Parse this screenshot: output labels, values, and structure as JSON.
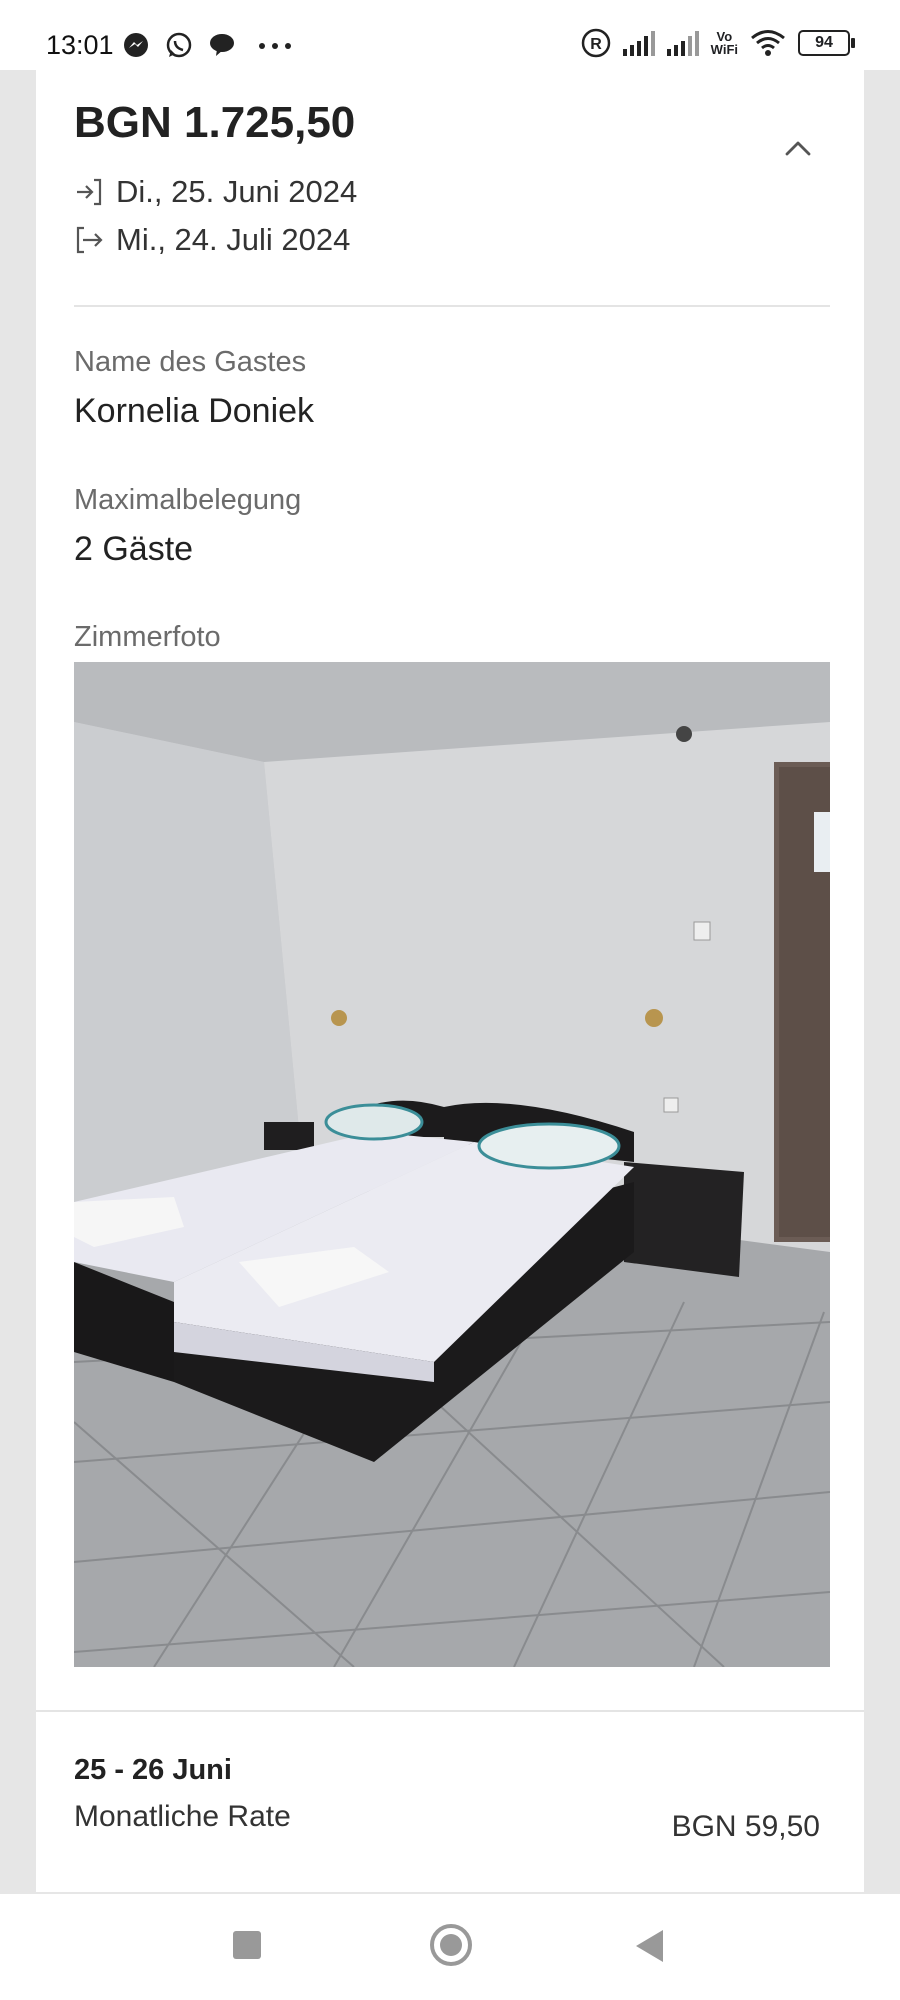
{
  "status_bar": {
    "time": "13:01",
    "battery": "94",
    "vowifi_top": "Vo",
    "vowifi_bottom": "WiFi",
    "icons": [
      "messenger-icon",
      "whatsapp-icon",
      "chat-icon",
      "more-dots-icon",
      "registered-icon",
      "signal-icon",
      "signal-icon",
      "vowifi-icon",
      "wifi-icon",
      "battery-icon"
    ]
  },
  "booking": {
    "price": "BGN 1.725,50",
    "checkin": "Di., 25. Juni 2024",
    "checkout": "Mi., 24. Juli 2024",
    "guest_name_label": "Name des Gastes",
    "guest_name": "Kornelia Doniek",
    "occupancy_label": "Maximalbelegung",
    "occupancy": "2 Gäste",
    "photo_label": "Zimmerfoto"
  },
  "rate": {
    "range": "25 - 26 Juni",
    "label": "Monatliche Rate",
    "value": "BGN 59,50"
  },
  "nav": {
    "icons": [
      "recents-icon",
      "home-icon",
      "back-icon"
    ]
  }
}
